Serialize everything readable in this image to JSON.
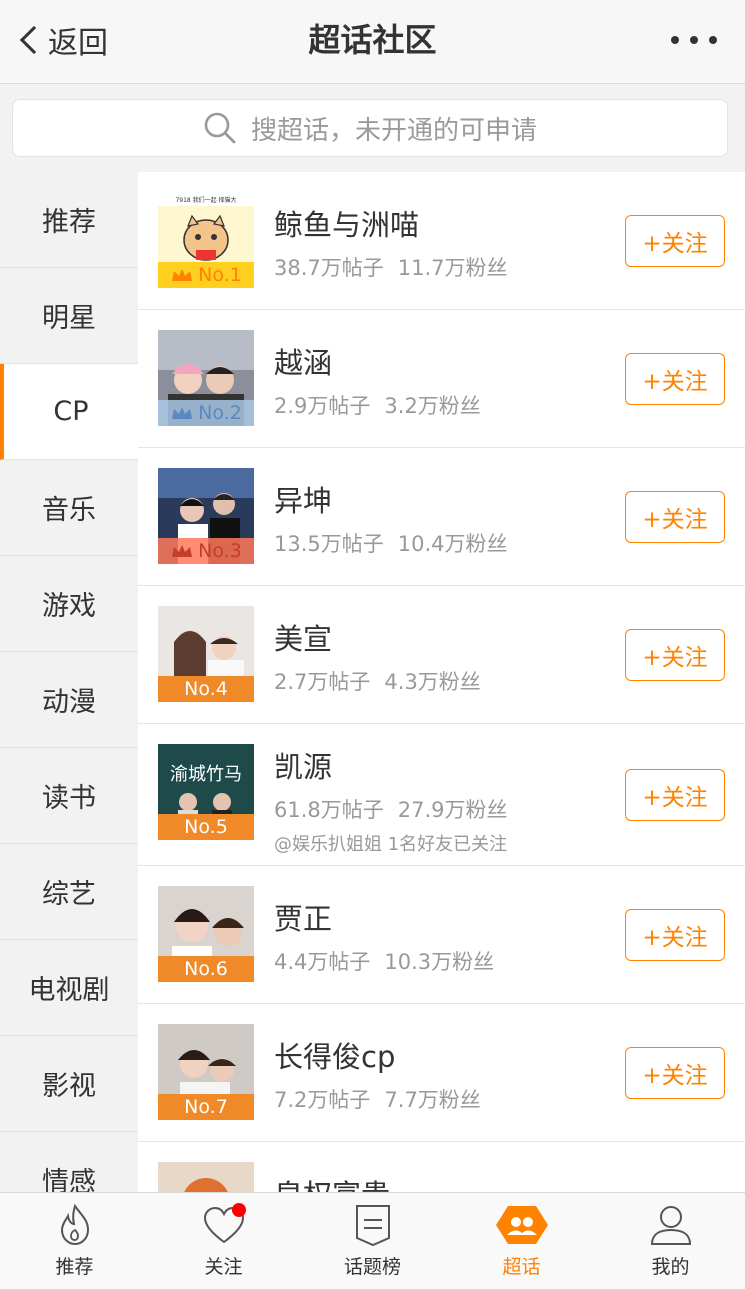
{
  "header": {
    "back_label": "返回",
    "title": "超话社区"
  },
  "search": {
    "placeholder": "搜超话，未开通的可申请"
  },
  "categories": [
    "推荐",
    "明星",
    "CP",
    "音乐",
    "游戏",
    "动漫",
    "读书",
    "综艺",
    "电视剧",
    "影视",
    "情感"
  ],
  "active_category": "CP",
  "items": [
    {
      "rank": "No.1",
      "name": "鲸鱼与洲喵",
      "posts": "38.7万帖子",
      "fans": "11.7万粉丝",
      "follow": "+关注",
      "thumb_text": "7918 我们一起 择猫大"
    },
    {
      "rank": "No.2",
      "name": "越涵",
      "posts": "2.9万帖子",
      "fans": "3.2万粉丝",
      "follow": "+关注"
    },
    {
      "rank": "No.3",
      "name": "异坤",
      "posts": "13.5万帖子",
      "fans": "10.4万粉丝",
      "follow": "+关注"
    },
    {
      "rank": "No.4",
      "name": "美宣",
      "posts": "2.7万帖子",
      "fans": "4.3万粉丝",
      "follow": "+关注"
    },
    {
      "rank": "No.5",
      "name": "凯源",
      "posts": "61.8万帖子",
      "fans": "27.9万粉丝",
      "friends": "@娱乐扒姐姐 1名好友已关注",
      "follow": "+关注",
      "thumb_text": "渝城竹马"
    },
    {
      "rank": "No.6",
      "name": "贾正",
      "posts": "4.4万帖子",
      "fans": "10.3万粉丝",
      "follow": "+关注"
    },
    {
      "rank": "No.7",
      "name": "长得俊cp",
      "posts": "7.2万帖子",
      "fans": "7.7万粉丝",
      "follow": "+关注"
    },
    {
      "name": "皇权富贵"
    }
  ],
  "tabs": [
    {
      "label": "推荐",
      "icon": "flame-icon"
    },
    {
      "label": "关注",
      "icon": "heart-icon",
      "badge": true
    },
    {
      "label": "话题榜",
      "icon": "document-icon"
    },
    {
      "label": "超话",
      "icon": "super-topic-icon",
      "active": true
    },
    {
      "label": "我的",
      "icon": "user-icon"
    }
  ],
  "colors": {
    "accent": "#ff8200",
    "badge": "#ff0000"
  }
}
